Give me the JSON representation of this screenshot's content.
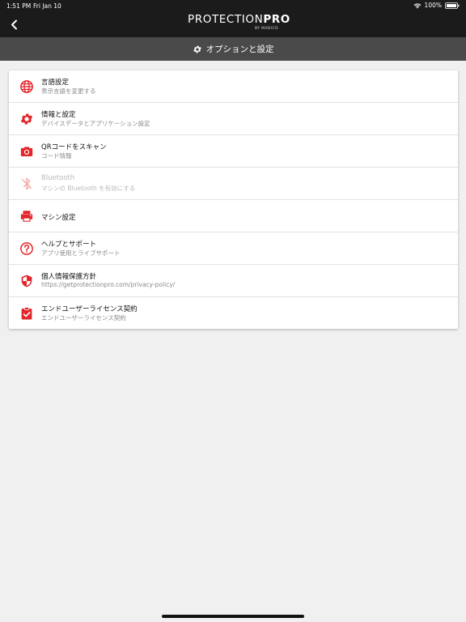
{
  "status_bar": {
    "time": "1:51 PM",
    "date": "Fri Jan 10",
    "battery": "100%"
  },
  "header": {
    "logo_main": "PROTECTION",
    "logo_pro": "PRO",
    "logo_sub": "BY MADICO"
  },
  "subheader": {
    "title": "オプションと設定"
  },
  "menu": {
    "items": [
      {
        "title": "言語設定",
        "subtitle": "表示言語を変更する",
        "icon": "globe-icon"
      },
      {
        "title": "情報と設定",
        "subtitle": "デバイスデータとアプリケーション設定",
        "icon": "gear-icon"
      },
      {
        "title": "QRコードをスキャン",
        "subtitle": "コード情報",
        "icon": "camera-icon"
      },
      {
        "title": "Bluetooth",
        "subtitle": "マシンの Bluetooth を有効にする",
        "icon": "bluetooth-icon"
      },
      {
        "title": "マシン設定",
        "subtitle": "",
        "icon": "printer-icon"
      },
      {
        "title": "ヘルプとサポート",
        "subtitle": "アプリ使用とライブサポート",
        "icon": "help-icon"
      },
      {
        "title": "個人情報保護方針",
        "subtitle": "https://getprotectionpro.com/privacy-policy/",
        "icon": "shield-icon"
      },
      {
        "title": "エンドユーザーライセンス契約",
        "subtitle": "エンドユーザーライセンス契約",
        "icon": "clipboard-check-icon"
      }
    ]
  },
  "colors": {
    "accent": "#e3262b",
    "disabled": "#f3a9a9",
    "topbar": "#1b1b1b",
    "subheader": "#4a4a4a"
  }
}
